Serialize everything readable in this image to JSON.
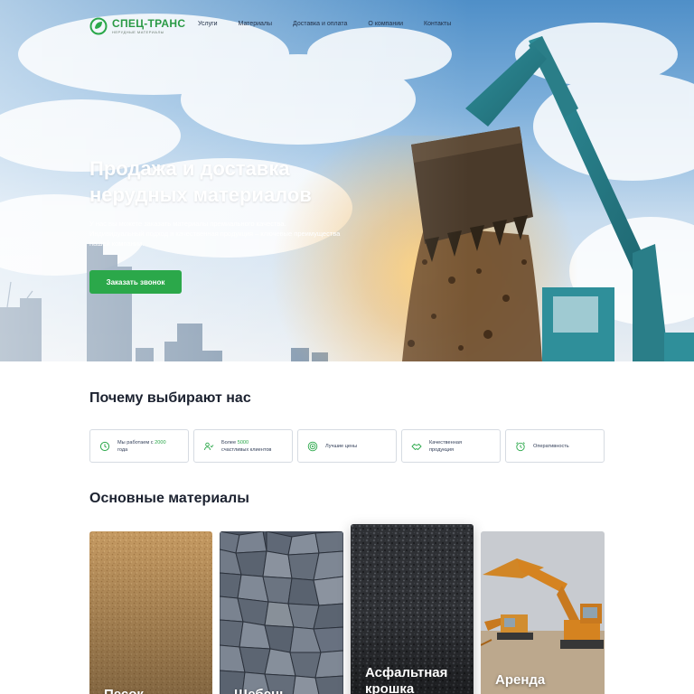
{
  "brand": {
    "name": "СПЕЦ-ТРАНС",
    "tagline": "НЕРУДНЫЕ МАТЕРИАЛЫ",
    "color": "#2ba84a"
  },
  "nav": {
    "items": [
      {
        "label": "Услуги"
      },
      {
        "label": "Материалы"
      },
      {
        "label": "Доставка и оплата"
      },
      {
        "label": "О компании"
      },
      {
        "label": "Контакты"
      }
    ]
  },
  "hero": {
    "title_line1": "Продажа и доставка",
    "title_line2": "нерудных материалов",
    "subtitle_line1": "У нас вы можете заказать материалы премиального качества.",
    "subtitle_line2": "Индивидуальный подход и качественная продукция – ключевые преимущества",
    "subtitle_line3": "нашей компании.",
    "cta_label": "Заказать звонок"
  },
  "why": {
    "title": "Почему выбирают нас",
    "items": [
      {
        "icon": "clock-history-icon",
        "line1_a": "Мы работаем с ",
        "line1_b": "2000",
        "line2": "года"
      },
      {
        "icon": "users-icon",
        "line1_a": "Более ",
        "line1_b": "5000",
        "line2": "счастливых клиентов"
      },
      {
        "icon": "target-icon",
        "line1_a": "Лучшие цены",
        "line1_b": "",
        "line2": ""
      },
      {
        "icon": "handshake-icon",
        "line1_a": "Качественная",
        "line1_b": "",
        "line2": "продукция"
      },
      {
        "icon": "alarm-clock-icon",
        "line1_a": "Оперативность",
        "line1_b": "",
        "line2": ""
      }
    ]
  },
  "materials": {
    "title": "Основные материалы",
    "items": [
      {
        "label": "Песок",
        "image": "sand"
      },
      {
        "label": "Щебень",
        "image": "crushed-stone"
      },
      {
        "label": "Асфальтная крошка",
        "line1": "Асфальтная",
        "line2": "крошка",
        "image": "asphalt-chips"
      },
      {
        "label": "Аренда",
        "image": "excavators"
      }
    ]
  }
}
